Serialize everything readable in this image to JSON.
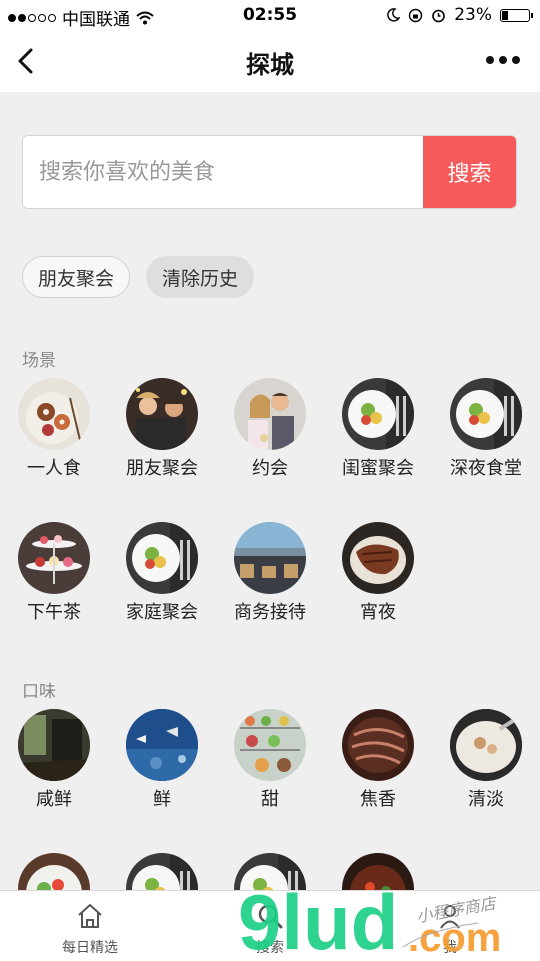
{
  "status_bar": {
    "carrier": "中国联通",
    "time": "02:55",
    "battery": "23%"
  },
  "nav": {
    "title": "探城",
    "back_icon": "chevron-left-icon",
    "more_icon": "more-dots-icon"
  },
  "search": {
    "placeholder": "搜索你喜欢的美食",
    "button_label": "搜索"
  },
  "history": {
    "chips": [
      "朋友聚会"
    ],
    "clear_label": "清除历史"
  },
  "scenes": {
    "title": "场景",
    "items": [
      {
        "label": "一人食",
        "image": "donut-plate"
      },
      {
        "label": "朋友聚会",
        "image": "party-people"
      },
      {
        "label": "约会",
        "image": "couple"
      },
      {
        "label": "闺蜜聚会",
        "image": "plate-cutlery"
      },
      {
        "label": "深夜食堂",
        "image": "plate-cutlery"
      },
      {
        "label": "下午茶",
        "image": "cake-stand"
      },
      {
        "label": "家庭聚会",
        "image": "plate-cutlery"
      },
      {
        "label": "商务接待",
        "image": "harbor-restaurant"
      },
      {
        "label": "宵夜",
        "image": "grilled-meat"
      }
    ]
  },
  "tastes": {
    "title": "口味",
    "items": [
      {
        "label": "咸鲜",
        "image": "dark-interior"
      },
      {
        "label": "鲜",
        "image": "aquarium"
      },
      {
        "label": "甜",
        "image": "dessert-shelf"
      },
      {
        "label": "焦香",
        "image": "grilled-steak"
      },
      {
        "label": "清淡",
        "image": "soup-bowl"
      }
    ],
    "more_items": [
      {
        "image": "salad"
      },
      {
        "image": "plate-cutlery"
      },
      {
        "image": "plate-cutlery"
      },
      {
        "image": "stir-fry"
      }
    ]
  },
  "tabbar": {
    "tabs": [
      {
        "label": "每日精选",
        "icon": "home-icon"
      },
      {
        "label": "搜索",
        "icon": "search-icon"
      },
      {
        "label": "我",
        "icon": "user-icon"
      }
    ]
  },
  "watermark": {
    "brand": "9lud",
    "domain": ".com",
    "tagline": "小程序商店"
  },
  "colors": {
    "accent": "#f65a5a",
    "background": "#efefef"
  }
}
